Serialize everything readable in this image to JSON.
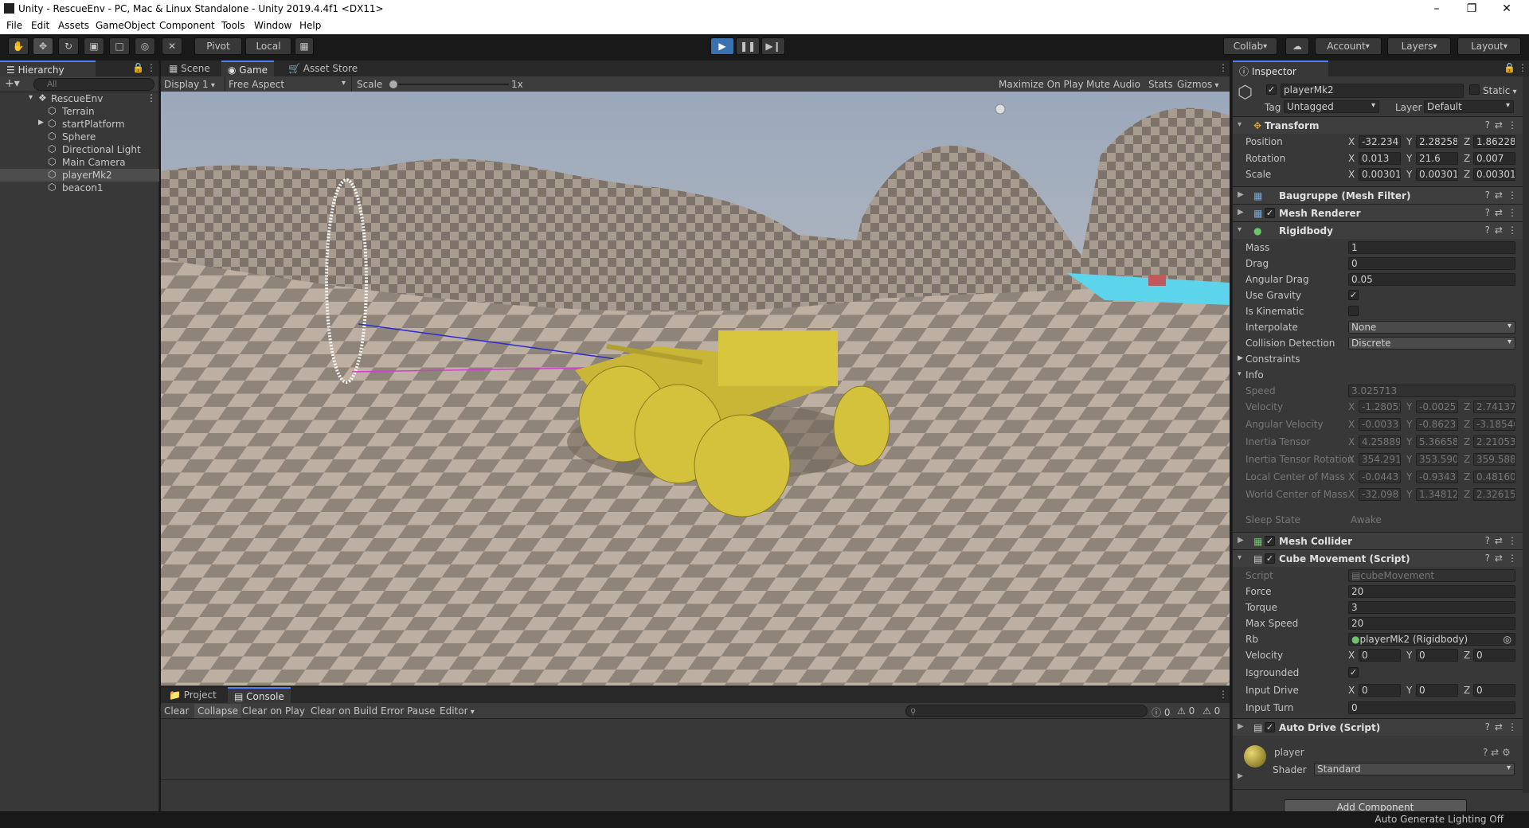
{
  "window": {
    "title": "Unity - RescueEnv - PC, Mac & Linux Standalone - Unity 2019.4.4f1 <DX11>",
    "min": "–",
    "max": "❐",
    "close": "✕"
  },
  "menu": [
    "File",
    "Edit",
    "Assets",
    "GameObject",
    "Component",
    "Tools",
    "Window",
    "Help"
  ],
  "toolbar": {
    "pivot": "Pivot",
    "local": "Local",
    "collab": "Collab",
    "account": "Account",
    "layers": "Layers",
    "layout": "Layout"
  },
  "hierarchy": {
    "tab": "Hierarchy",
    "search_placeholder": "All",
    "scene": "RescueEnv",
    "items": [
      "Terrain",
      "startPlatform",
      "Sphere",
      "Directional Light",
      "Main Camera",
      "playerMk2",
      "beacon1"
    ]
  },
  "game": {
    "tabs": [
      "Scene",
      "Game",
      "Asset Store"
    ],
    "display": "Display 1",
    "aspect": "Free Aspect",
    "scale_label": "Scale",
    "scale_value": "1x",
    "maximize": "Maximize On Play",
    "mute": "Mute Audio",
    "stats": "Stats",
    "gizmos": "Gizmos"
  },
  "console": {
    "tabs": [
      "Project",
      "Console"
    ],
    "buttons": [
      "Clear",
      "Collapse",
      "Clear on Play",
      "Clear on Build",
      "Error Pause",
      "Editor"
    ],
    "counts": [
      "0",
      "0",
      "0"
    ]
  },
  "inspector": {
    "tab": "Inspector",
    "object_name": "playerMk2",
    "static_label": "Static",
    "tag_label": "Tag",
    "tag": "Untagged",
    "layer_label": "Layer",
    "layer": "Default",
    "transform": {
      "title": "Transform",
      "position": {
        "label": "Position",
        "x": "-32.234",
        "y": "2.282586",
        "z": "1.862287"
      },
      "rotation": {
        "label": "Rotation",
        "x": "0.013",
        "y": "21.6",
        "z": "0.007"
      },
      "scale": {
        "label": "Scale",
        "x": "0.00301",
        "y": "0.00301",
        "z": "0.00301"
      }
    },
    "mesh_filter": "Baugruppe (Mesh Filter)",
    "mesh_renderer": "Mesh Renderer",
    "rigidbody": {
      "title": "Rigidbody",
      "fields": [
        {
          "label": "Mass",
          "value": "1"
        },
        {
          "label": "Drag",
          "value": "0"
        },
        {
          "label": "Angular Drag",
          "value": "0.05"
        }
      ],
      "use_gravity": "Use Gravity",
      "is_kinematic": "Is Kinematic",
      "interpolate": {
        "label": "Interpolate",
        "value": "None"
      },
      "collision": {
        "label": "Collision Detection",
        "value": "Discrete"
      },
      "constraints": "Constraints",
      "info": "Info",
      "speed": {
        "label": "Speed",
        "value": "3.025713"
      },
      "vec_rows": [
        {
          "label": "Velocity",
          "x": "-1.28055",
          "y": "-0.0025",
          "z": "2.74137"
        },
        {
          "label": "Angular Velocity",
          "x": "-0.0033",
          "y": "-0.8623",
          "z": "-3.18540"
        },
        {
          "label": "Inertia Tensor",
          "x": "4.25889",
          "y": "5.36658",
          "z": "2.21053"
        },
        {
          "label": "Inertia Tensor Rotation",
          "x": "354.291",
          "y": "353.590",
          "z": "359.588"
        },
        {
          "label": "Local Center of Mass",
          "x": "-0.0443",
          "y": "-0.9343",
          "z": "0.48160"
        },
        {
          "label": "World Center of Mass",
          "x": "-32.098",
          "y": "1.348122",
          "z": "2.32615"
        }
      ],
      "sleep": {
        "label": "Sleep State",
        "value": "Awake"
      }
    },
    "mesh_collider": "Mesh Collider",
    "cube_movement": {
      "title": "Cube Movement (Script)",
      "script": {
        "label": "Script",
        "value": "cubeMovement"
      },
      "force": {
        "label": "Force",
        "value": "20"
      },
      "torque": {
        "label": "Torque",
        "value": "3"
      },
      "max_speed": {
        "label": "Max Speed",
        "value": "20"
      },
      "rb": {
        "label": "Rb",
        "value": "playerMk2 (Rigidbody)"
      },
      "velocity": {
        "label": "Velocity",
        "x": "0",
        "y": "0",
        "z": "0"
      },
      "isgrounded": "Isgrounded",
      "input_drive": {
        "label": "Input Drive",
        "x": "0",
        "y": "0",
        "z": "0"
      },
      "input_turn": {
        "label": "Input Turn",
        "value": "0"
      }
    },
    "auto_drive": "Auto Drive (Script)",
    "material": {
      "name": "player",
      "shader_label": "Shader",
      "shader": "Standard"
    },
    "add_component": "Add Component"
  },
  "status": "Auto Generate Lighting Off"
}
